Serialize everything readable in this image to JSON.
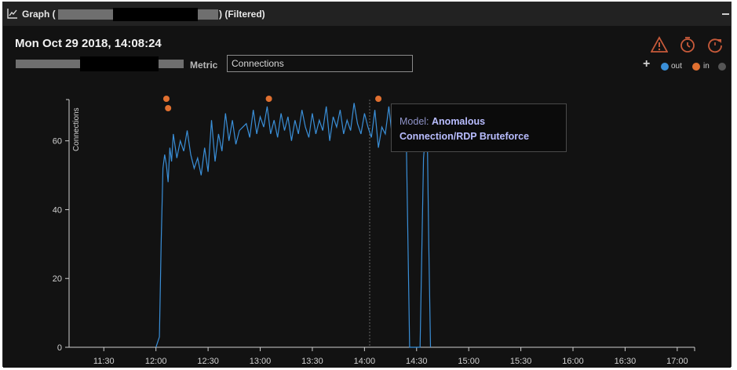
{
  "window": {
    "title_prefix": "Graph (",
    "title_suffix": ") (Filtered)"
  },
  "header": {
    "timestamp": "Mon Oct 29 2018, 14:08:24",
    "metric_label": "Metric",
    "metric_value": "Connections"
  },
  "legend": {
    "plus": "+",
    "items": [
      {
        "label": "out",
        "color": "#3a8fd8"
      },
      {
        "label": "in",
        "color": "#e07030"
      },
      {
        "label": "",
        "color": "#555555"
      }
    ]
  },
  "tooltip": {
    "key": "Model:",
    "value_line1": "Anomalous",
    "value_line2": "Connection/RDP Bruteforce"
  },
  "chart_data": {
    "type": "line",
    "ylabel": "Connections",
    "ylim": [
      0,
      72
    ],
    "yticks": [
      0,
      20,
      40,
      60
    ],
    "xticks": [
      "11:30",
      "12:00",
      "12:30",
      "13:00",
      "13:30",
      "14:00",
      "14:30",
      "15:00",
      "15:30",
      "16:00",
      "16:30",
      "17:00"
    ],
    "xlim": [
      "11:10",
      "17:10"
    ],
    "series": [
      {
        "name": "out",
        "color": "#3a8fd8",
        "x": [
          "12:00",
          "12:02",
          "12:03",
          "12:04",
          "12:05",
          "12:06",
          "12:07",
          "12:08",
          "12:09",
          "12:10",
          "12:12",
          "12:14",
          "12:16",
          "12:18",
          "12:20",
          "12:22",
          "12:24",
          "12:26",
          "12:28",
          "12:30",
          "12:32",
          "12:34",
          "12:36",
          "12:38",
          "12:40",
          "12:42",
          "12:44",
          "12:46",
          "12:48",
          "12:50",
          "12:52",
          "12:54",
          "12:56",
          "12:58",
          "13:00",
          "13:02",
          "13:04",
          "13:06",
          "13:08",
          "13:10",
          "13:12",
          "13:14",
          "13:16",
          "13:18",
          "13:20",
          "13:22",
          "13:24",
          "13:26",
          "13:28",
          "13:30",
          "13:32",
          "13:34",
          "13:36",
          "13:38",
          "13:40",
          "13:42",
          "13:44",
          "13:46",
          "13:48",
          "13:50",
          "13:52",
          "13:54",
          "13:56",
          "13:58",
          "14:00",
          "14:02",
          "14:04",
          "14:06",
          "14:08",
          "14:10",
          "14:12",
          "14:14",
          "14:16",
          "14:18",
          "14:20",
          "14:22",
          "14:24",
          "14:26",
          "14:28",
          "14:30",
          "14:32",
          "14:34",
          "14:36",
          "14:37",
          "14:38"
        ],
        "values": [
          0,
          3,
          30,
          52,
          56,
          53,
          48,
          58,
          54,
          62,
          55,
          60,
          57,
          63,
          56,
          52,
          55,
          50,
          58,
          51,
          66,
          54,
          62,
          57,
          68,
          60,
          66,
          59,
          63,
          64,
          65,
          61,
          69,
          62,
          67,
          64,
          70,
          62,
          66,
          61,
          68,
          63,
          67,
          60,
          66,
          62,
          69,
          64,
          61,
          68,
          62,
          66,
          63,
          70,
          60,
          67,
          64,
          69,
          62,
          66,
          63,
          71,
          65,
          62,
          68,
          64,
          61,
          69,
          58,
          64,
          62,
          70,
          61,
          66,
          68,
          67,
          63,
          0,
          0,
          0,
          0,
          55,
          67,
          30,
          0
        ]
      }
    ],
    "model_breaches": [
      "12:06",
      "12:07",
      "13:05",
      "14:08"
    ],
    "cursor_time": "14:03"
  }
}
